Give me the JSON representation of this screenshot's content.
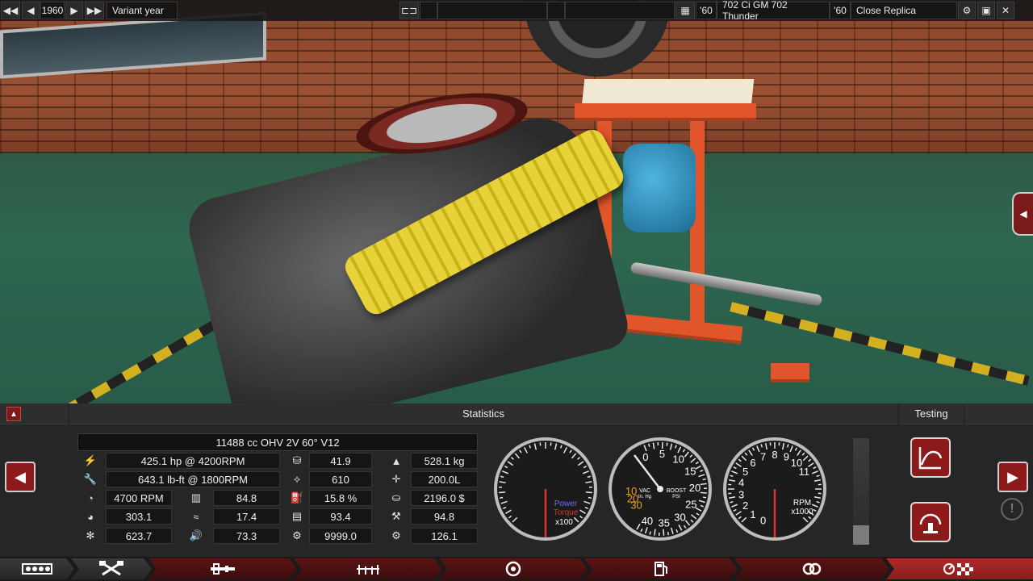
{
  "topbar": {
    "back_first_icon": "rewind-icon",
    "year": "1960",
    "variant_label": "Variant year",
    "model_year": "'60",
    "model_name": "702 Ci GM 702 Thunder",
    "trim_year": "'60",
    "trim_name": "Close Replica"
  },
  "panel": {
    "statistics_title": "Statistics",
    "testing_title": "Testing",
    "engine_name": "11488 cc OHV 2V 60° V12",
    "col1": [
      "425.1 hp @ 4200RPM",
      "643.1 lb-ft @ 1800RPM",
      "4700 RPM",
      "303.1",
      "623.7"
    ],
    "col2": [
      "84.8",
      "17.4",
      "73.3"
    ],
    "col3": [
      "41.9",
      "610",
      "15.8 %",
      "93.4",
      "9999.0"
    ],
    "col4": [
      "528.1 kg",
      "200.0L",
      "2196.0 $",
      "94.8",
      "126.1"
    ]
  },
  "gauges": {
    "power_label": "Power",
    "torque_label": "Torque",
    "power_scale": "x100",
    "vac_label": "VAC",
    "vac_unit": "In. Hg",
    "boost_label": "BOOST",
    "boost_unit": "PSI",
    "rpm_label": "RPM",
    "rpm_scale": "x1000",
    "boost_ticks": [
      "0",
      "5",
      "10",
      "15",
      "20",
      "25",
      "30",
      "35",
      "40"
    ],
    "vac_ticks": [
      "10",
      "20",
      "30"
    ],
    "rpm_ticks": [
      "0",
      "1",
      "2",
      "3",
      "4",
      "5",
      "6",
      "7",
      "8",
      "9",
      "10",
      "11",
      "3",
      "1"
    ],
    "throttle_level": 0.18
  },
  "colors": {
    "accent": "#8d1a1a",
    "power": "#6a6cff",
    "torque": "#e03030",
    "needle": "#e03030"
  }
}
